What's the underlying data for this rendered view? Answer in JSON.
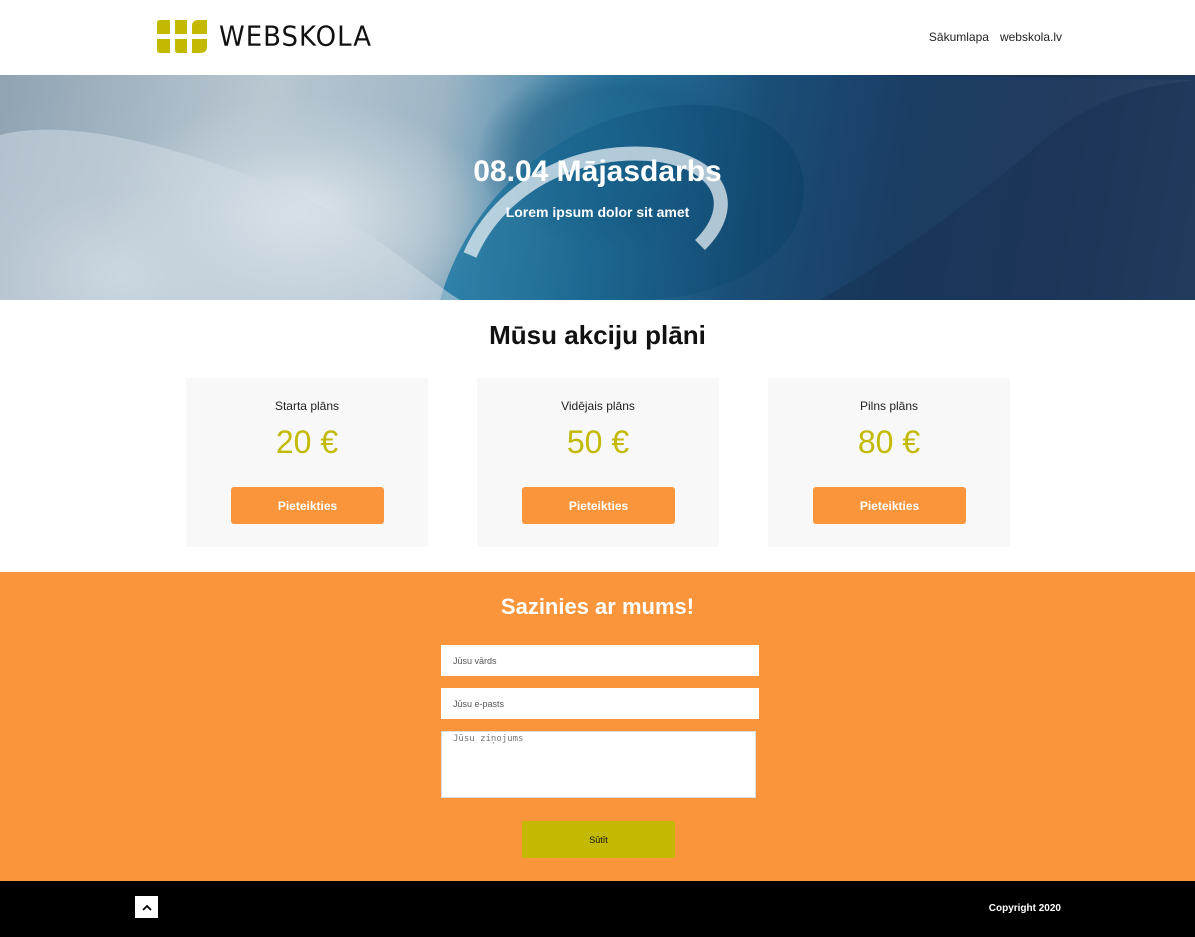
{
  "header": {
    "logo_text": "WEBSKOLA",
    "nav": [
      "Sākumlapa",
      "webskola.lv"
    ]
  },
  "hero": {
    "title": "08.04 Mājasdarbs",
    "subtitle": "Lorem ipsum dolor sit amet"
  },
  "plans": {
    "title": "Mūsu akciju plāni",
    "items": [
      {
        "name": "Starta plāns",
        "price": "20 €",
        "button": "Pieteikties"
      },
      {
        "name": "Vidējais plāns",
        "price": "50 €",
        "button": "Pieteikties"
      },
      {
        "name": "Pilns plāns",
        "price": "80 €",
        "button": "Pieteikties"
      }
    ]
  },
  "contact": {
    "title": "Sazinies ar mums!",
    "name_placeholder": "Jūsu vārds",
    "email_placeholder": "Jūsu e-pasts",
    "message_placeholder": "Jūsu ziņojums",
    "submit_label": "Sūtīt"
  },
  "footer": {
    "copyright": "Copyright 2020",
    "scroll_top_icon": "chevron-up-icon"
  },
  "colors": {
    "accent_orange": "#fb953c",
    "brand_olive": "#c2b900",
    "footer_bg": "#000000"
  }
}
